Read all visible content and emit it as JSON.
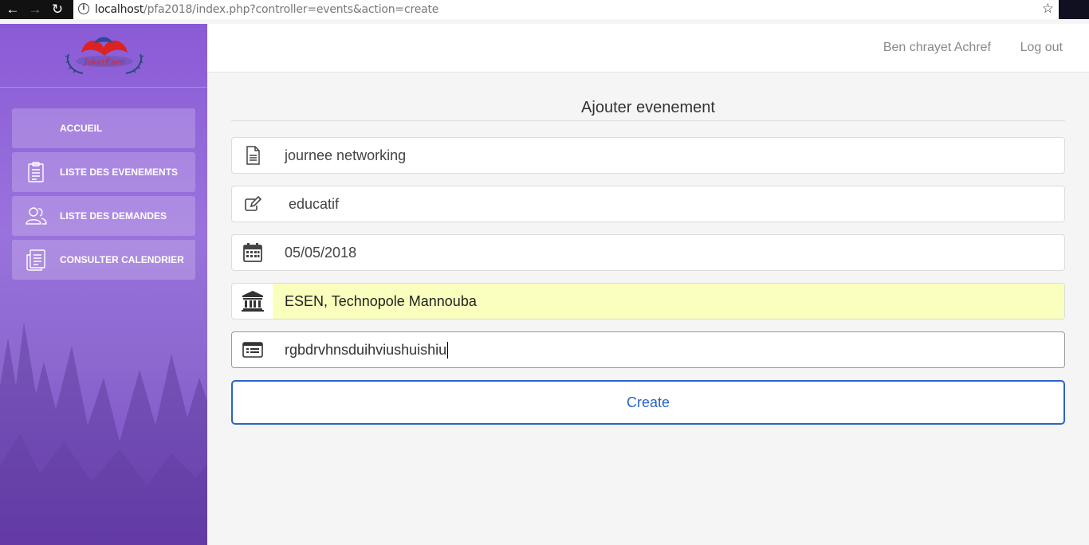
{
  "browser": {
    "url_host": "localhost",
    "url_path": "/pfa2018/index.php?controller=events&action=create"
  },
  "sidebar": {
    "logo_text": "JokerEsen",
    "items": [
      {
        "label": "ACCUEIL",
        "icon": "home-icon"
      },
      {
        "label": "LISTE DES EVENEMENTS",
        "icon": "clipboard-list-icon"
      },
      {
        "label": "LISTE DES DEMANDES",
        "icon": "users-icon"
      },
      {
        "label": "CONSULTER CALENDRIER",
        "icon": "calendar-doc-icon"
      }
    ]
  },
  "header": {
    "user_name": "Ben chrayet Achref",
    "logout_label": "Log out"
  },
  "form": {
    "title": "Ajouter evenement",
    "fields": [
      {
        "name": "title",
        "icon": "document-icon",
        "value": "journee networking"
      },
      {
        "name": "type",
        "icon": "edit-icon",
        "value": " educatif"
      },
      {
        "name": "date",
        "icon": "calendar-icon",
        "value": "05/05/2018"
      },
      {
        "name": "location",
        "icon": "institution-icon",
        "value": "ESEN, Technopole Mannouba"
      },
      {
        "name": "description",
        "icon": "list-icon",
        "value": "rgbdrvhnsduihviushuishiu"
      }
    ],
    "submit_label": "Create"
  },
  "colors": {
    "sidebar_top": "#8a5bd6",
    "sidebar_bottom": "#7a4ac4",
    "accent": "#2a64c5",
    "autofill": "#faffbd"
  }
}
